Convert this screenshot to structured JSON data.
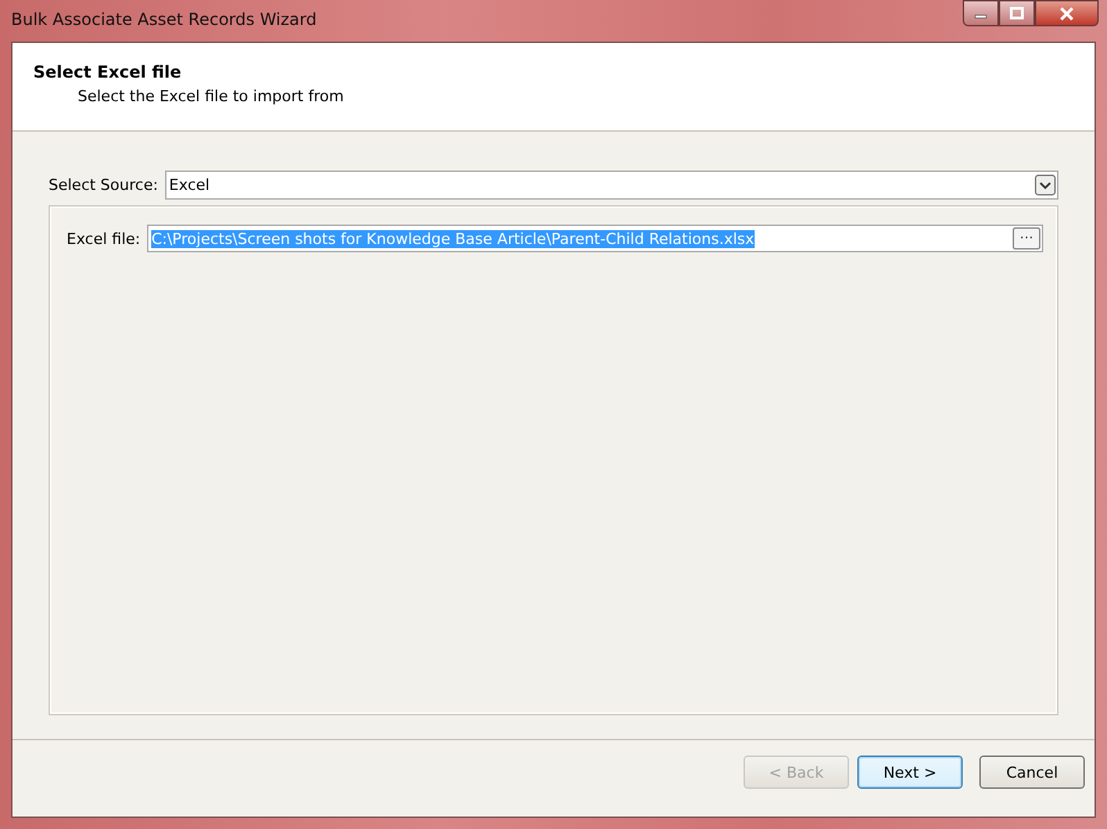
{
  "window": {
    "title": "Bulk Associate Asset Records Wizard"
  },
  "header": {
    "title": "Select Excel file",
    "subtitle": "Select the Excel file to import from"
  },
  "source": {
    "label": "Select Source:",
    "value": "Excel"
  },
  "file": {
    "label": "Excel file:",
    "value": "C:\\Projects\\Screen shots for Knowledge Base Article\\Parent-Child Relations.xlsx",
    "selected": true,
    "browse_label": "···"
  },
  "buttons": [
    {
      "label": "< Back",
      "disabled": true,
      "default": false
    },
    {
      "label": "Next >",
      "disabled": false,
      "default": true
    },
    {
      "label": "Cancel",
      "disabled": false,
      "default": false
    }
  ]
}
